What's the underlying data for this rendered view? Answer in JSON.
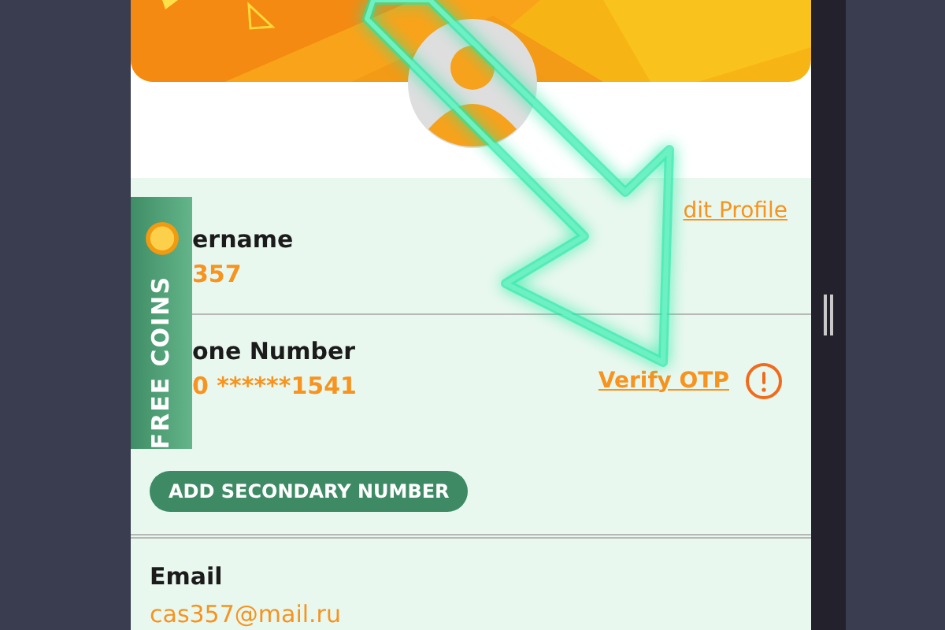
{
  "edit_link": "dit Profile",
  "free_coins": "FREE COINS",
  "fields": [
    {
      "label": "ername",
      "value": "357"
    },
    {
      "label": "one Number",
      "value": "0 ******1541",
      "action": "Verify OTP"
    }
  ],
  "secondary_button": "ADD SECONDARY NUMBER",
  "email": {
    "label": "Email",
    "value": "cas357@mail.ru"
  }
}
